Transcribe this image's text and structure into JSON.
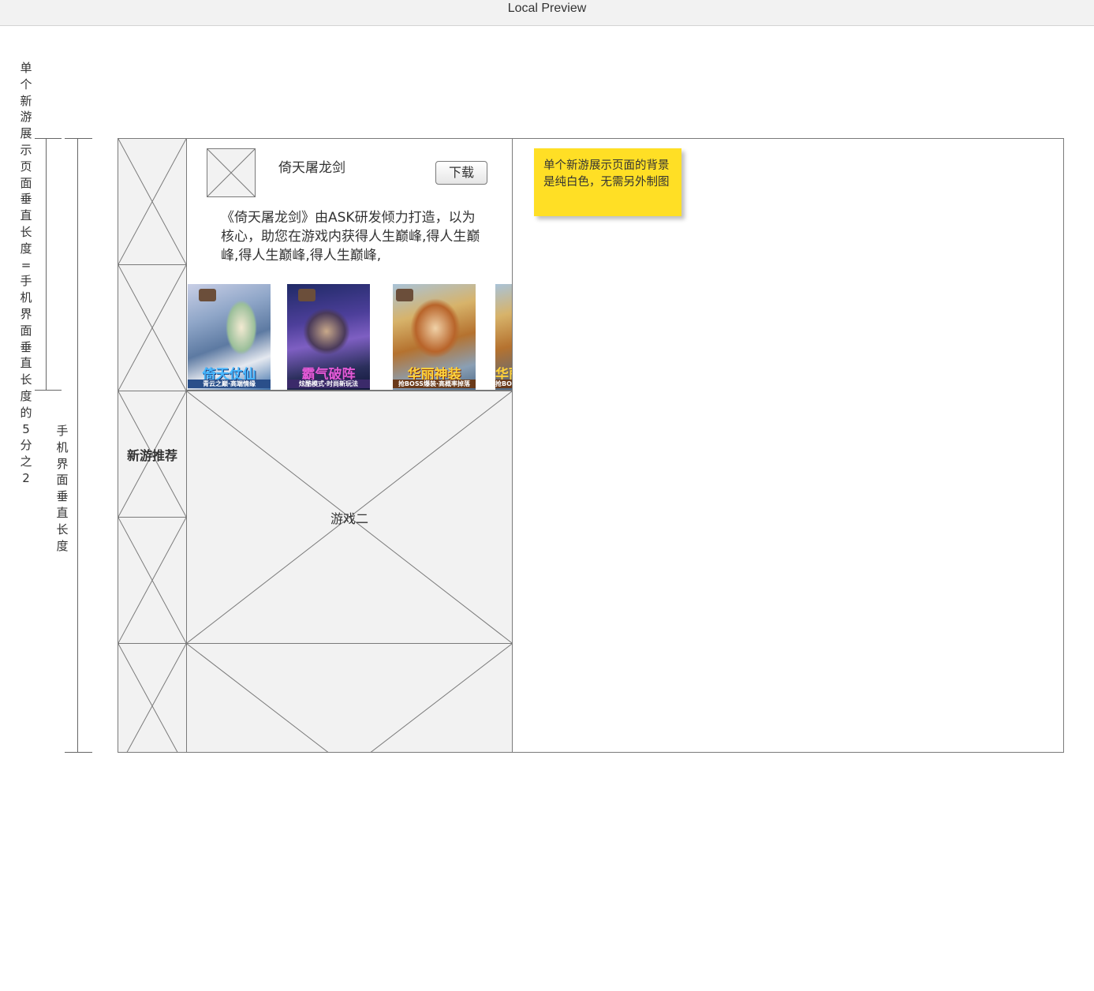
{
  "window": {
    "title": "Local Preview"
  },
  "annotations": {
    "left_vertical": "单个新游展示页面垂直长度=手机界面垂直长度的5分之2",
    "right_vertical": "手机界面垂直长度"
  },
  "game_detail": {
    "title": "倚天屠龙剑",
    "download_label": "下载",
    "description": "《倚天屠龙剑》由ASK研发倾力打造，以为核心，助您在游戏内获得人生巅峰,得人生巅峰,得人生巅峰,得人生巅峰,",
    "screenshots": [
      {
        "caption": "倚天仗仙",
        "subcaption": "青云之巅·高端情缘"
      },
      {
        "caption": "霸气破阵",
        "subcaption": "炫酷模式·时尚新玩法"
      },
      {
        "caption": "华丽神装",
        "subcaption": "抢BOSS爆装·高概率掉落"
      },
      {
        "caption": "华丽",
        "subcaption": "抢BO"
      }
    ]
  },
  "section": {
    "heading": "新游推荐"
  },
  "games": [
    {
      "label": "游戏二"
    }
  ],
  "sticky_note": {
    "text": "单个新游展示页面的背景是纯白色，无需另外制图"
  },
  "colors": {
    "note": "#ffdf25",
    "placeholder": "#f2f2f2",
    "border": "#7a7a7a"
  }
}
